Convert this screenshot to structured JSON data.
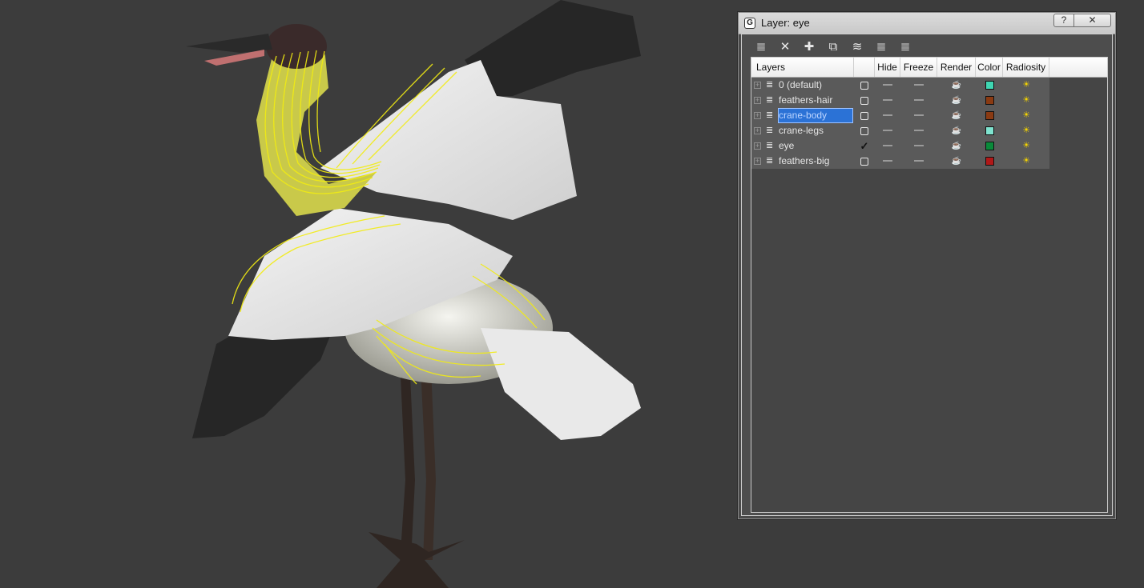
{
  "window": {
    "title": "Layer: eye",
    "help_label": "?",
    "close_label": "✕",
    "app_icon": "G"
  },
  "toolbar": {
    "tools": [
      {
        "icon": "new-layer-icon",
        "glyph": "≣"
      },
      {
        "icon": "delete-icon",
        "glyph": "✕"
      },
      {
        "icon": "add-icon",
        "glyph": "✚"
      },
      {
        "icon": "select-objects-icon",
        "glyph": "⧉"
      },
      {
        "icon": "highlight-layer-icon",
        "glyph": "≋"
      },
      {
        "icon": "hide-all-icon",
        "glyph": "≣"
      },
      {
        "icon": "freeze-all-icon",
        "glyph": "≣"
      }
    ]
  },
  "columns": {
    "layers": "Layers",
    "current": "",
    "hide": "Hide",
    "freeze": "Freeze",
    "render": "Render",
    "color": "Color",
    "radiosity": "Radiosity"
  },
  "layers": [
    {
      "name": "0 (default)",
      "current": false,
      "color": "#3fd6b2",
      "selected": false
    },
    {
      "name": "feathers-hair",
      "current": false,
      "color": "#8a3a12",
      "selected": false
    },
    {
      "name": "crane-body",
      "current": false,
      "color": "#8a3a12",
      "selected": true
    },
    {
      "name": "crane-legs",
      "current": false,
      "color": "#7fe3cf",
      "selected": false
    },
    {
      "name": "eye",
      "current": true,
      "color": "#0a8a3a",
      "selected": false
    },
    {
      "name": "feathers-big",
      "current": false,
      "color": "#b01818",
      "selected": false
    }
  ],
  "colors": {
    "viewport_bg": "#3c3c3c",
    "selection_wire": "#f2ec12",
    "selected_row": "#2b72d6"
  }
}
